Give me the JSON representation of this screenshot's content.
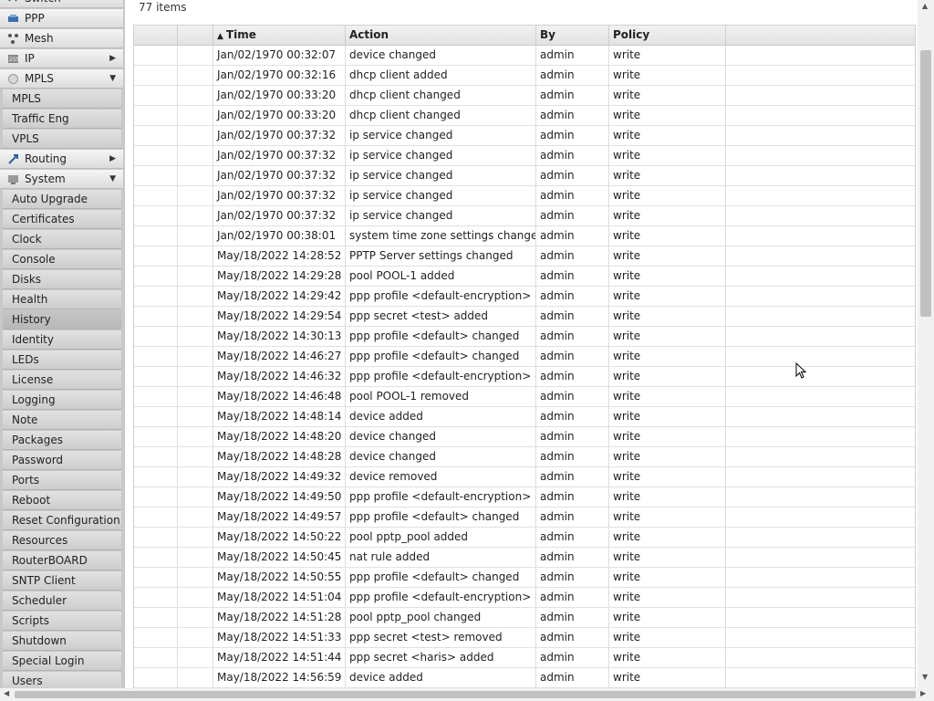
{
  "sidebar": {
    "top_items": [
      {
        "label": "Switch",
        "icon": "switch-icon"
      },
      {
        "label": "PPP",
        "icon": "ppp-icon"
      },
      {
        "label": "Mesh",
        "icon": "mesh-icon"
      },
      {
        "label": "IP",
        "icon": "ip-icon",
        "arrow": "▶"
      },
      {
        "label": "MPLS",
        "icon": "mpls-icon",
        "arrow": "▼"
      }
    ],
    "mpls_sub": [
      "MPLS",
      "Traffic Eng",
      "VPLS"
    ],
    "routing": {
      "label": "Routing",
      "icon": "routing-icon",
      "arrow": "▶"
    },
    "system": {
      "label": "System",
      "icon": "system-icon",
      "arrow": "▼"
    },
    "system_sub": [
      "Auto Upgrade",
      "Certificates",
      "Clock",
      "Console",
      "Disks",
      "Health",
      "History",
      "Identity",
      "LEDs",
      "License",
      "Logging",
      "Note",
      "Packages",
      "Password",
      "Ports",
      "Reboot",
      "Reset Configuration",
      "Resources",
      "RouterBOARD",
      "SNTP Client",
      "Scheduler",
      "Scripts",
      "Shutdown",
      "Special Login",
      "Users"
    ],
    "active_item": "History"
  },
  "main": {
    "item_count": "77 items",
    "columns": [
      "",
      "",
      "Time",
      "Action",
      "By",
      "Policy",
      ""
    ],
    "sort_indicator": "▲",
    "rows": [
      [
        "Jan/02/1970 00:32:07",
        "device changed",
        "admin",
        "write"
      ],
      [
        "Jan/02/1970 00:32:16",
        "dhcp client added",
        "admin",
        "write"
      ],
      [
        "Jan/02/1970 00:33:20",
        "dhcp client changed",
        "admin",
        "write"
      ],
      [
        "Jan/02/1970 00:33:20",
        "dhcp client changed",
        "admin",
        "write"
      ],
      [
        "Jan/02/1970 00:37:32",
        "ip service changed",
        "admin",
        "write"
      ],
      [
        "Jan/02/1970 00:37:32",
        "ip service changed",
        "admin",
        "write"
      ],
      [
        "Jan/02/1970 00:37:32",
        "ip service changed",
        "admin",
        "write"
      ],
      [
        "Jan/02/1970 00:37:32",
        "ip service changed",
        "admin",
        "write"
      ],
      [
        "Jan/02/1970 00:37:32",
        "ip service changed",
        "admin",
        "write"
      ],
      [
        "Jan/02/1970 00:38:01",
        "system time zone settings changed",
        "admin",
        "write"
      ],
      [
        "May/18/2022 14:28:52",
        "PPTP Server settings changed",
        "admin",
        "write"
      ],
      [
        "May/18/2022 14:29:28",
        "pool POOL-1 added",
        "admin",
        "write"
      ],
      [
        "May/18/2022 14:29:42",
        "ppp profile <default-encryption> changed",
        "admin",
        "write"
      ],
      [
        "May/18/2022 14:29:54",
        "ppp secret <test> added",
        "admin",
        "write"
      ],
      [
        "May/18/2022 14:30:13",
        "ppp profile <default> changed",
        "admin",
        "write"
      ],
      [
        "May/18/2022 14:46:27",
        "ppp profile <default> changed",
        "admin",
        "write"
      ],
      [
        "May/18/2022 14:46:32",
        "ppp profile <default-encryption> changed",
        "admin",
        "write"
      ],
      [
        "May/18/2022 14:46:48",
        "pool POOL-1 removed",
        "admin",
        "write"
      ],
      [
        "May/18/2022 14:48:14",
        "device added",
        "admin",
        "write"
      ],
      [
        "May/18/2022 14:48:20",
        "device changed",
        "admin",
        "write"
      ],
      [
        "May/18/2022 14:48:28",
        "device changed",
        "admin",
        "write"
      ],
      [
        "May/18/2022 14:49:32",
        "device removed",
        "admin",
        "write"
      ],
      [
        "May/18/2022 14:49:50",
        "ppp profile <default-encryption> changed",
        "admin",
        "write"
      ],
      [
        "May/18/2022 14:49:57",
        "ppp profile <default> changed",
        "admin",
        "write"
      ],
      [
        "May/18/2022 14:50:22",
        "pool pptp_pool added",
        "admin",
        "write"
      ],
      [
        "May/18/2022 14:50:45",
        "nat rule added",
        "admin",
        "write"
      ],
      [
        "May/18/2022 14:50:55",
        "ppp profile <default> changed",
        "admin",
        "write"
      ],
      [
        "May/18/2022 14:51:04",
        "ppp profile <default-encryption> changed",
        "admin",
        "write"
      ],
      [
        "May/18/2022 14:51:28",
        "pool pptp_pool changed",
        "admin",
        "write"
      ],
      [
        "May/18/2022 14:51:33",
        "ppp secret <test> removed",
        "admin",
        "write"
      ],
      [
        "May/18/2022 14:51:44",
        "ppp secret <haris> added",
        "admin",
        "write"
      ],
      [
        "May/18/2022 14:56:59",
        "device added",
        "admin",
        "write"
      ]
    ]
  },
  "colors": {
    "sidebar_bg": "#c8c8c8",
    "active_item": "#b8b8b8",
    "grid_border": "#d0d0d0"
  }
}
